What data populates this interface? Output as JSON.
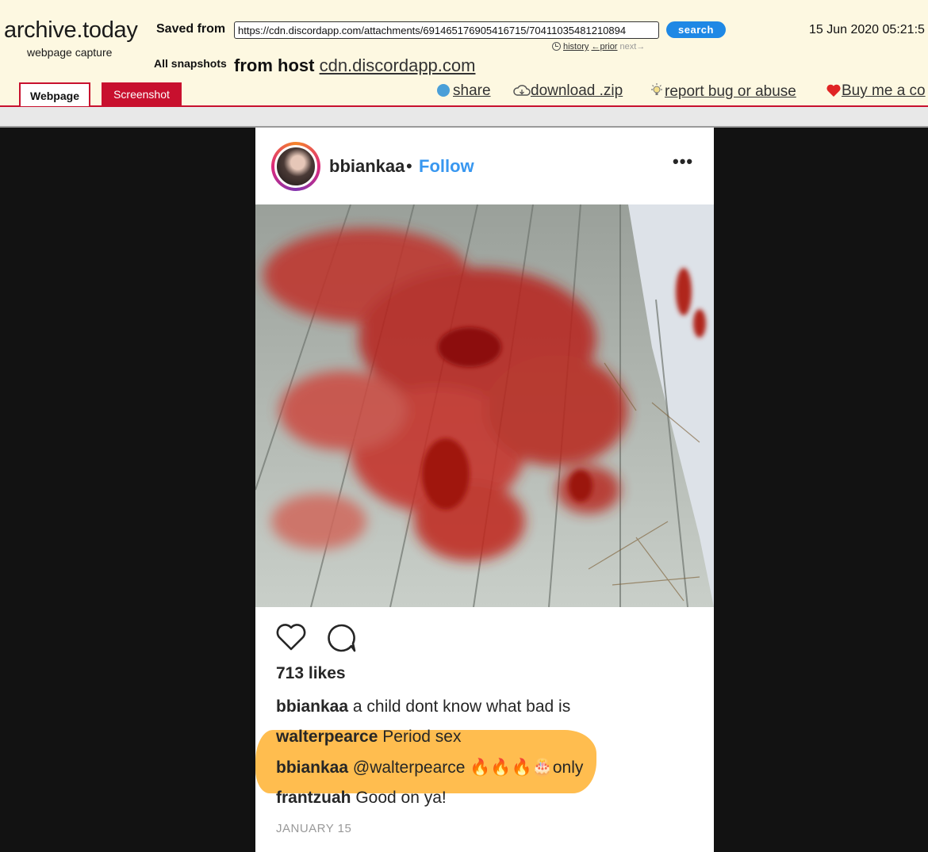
{
  "archive": {
    "logo": "archive.today",
    "logo_subtitle": "webpage capture",
    "saved_from_label": "Saved from",
    "url_value": "https://cdn.discordapp.com/attachments/691465176905416715/70411035481210894",
    "search_label": "search",
    "timestamp": "15 Jun 2020 05:21:5",
    "nav": {
      "history": "history",
      "prior": "←prior",
      "next": "next→"
    },
    "all_snapshots_label": "All snapshots",
    "from_host_label": "from host",
    "host": "cdn.discordapp.com",
    "tabs": {
      "webpage": "Webpage",
      "screenshot": "Screenshot"
    },
    "actions": {
      "share": "share",
      "download": "download .zip",
      "report": "report bug or abuse",
      "buy": "Buy me a co"
    }
  },
  "post": {
    "username": "bbiankaa",
    "separator": "•",
    "follow_label": "Follow",
    "more_label": "•••",
    "likes": "713 likes",
    "comments": [
      {
        "user": "bbiankaa",
        "text": "a child dont know what bad is"
      },
      {
        "user": "walterpearce",
        "text": "Period sex"
      },
      {
        "user": "bbiankaa",
        "text": "@walterpearce 🔥🔥🔥🎂only"
      },
      {
        "user": "frantzuah",
        "text": "Good on ya!"
      }
    ],
    "date": "JANUARY 15"
  },
  "colors": {
    "archive_red": "#c8102e",
    "archive_bg": "#fdf8e1",
    "follow_blue": "#3897f0",
    "highlight": "#ffaa1e"
  }
}
